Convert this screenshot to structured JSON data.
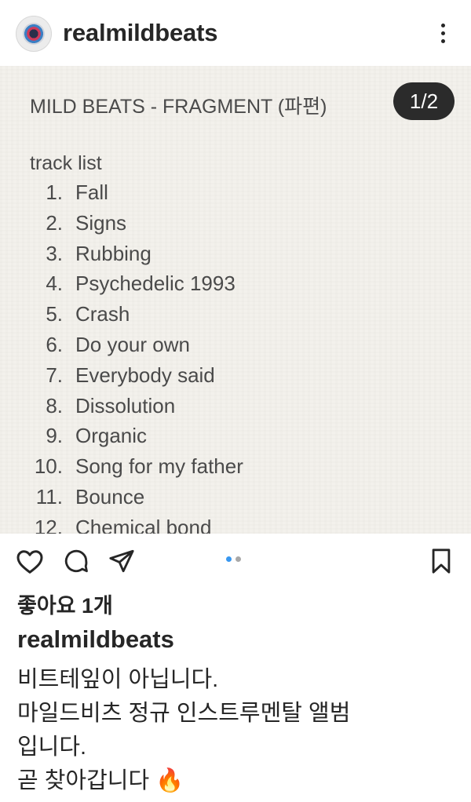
{
  "header": {
    "username": "realmildbeats",
    "more_icon": "more-vertical-icon"
  },
  "post": {
    "title": "MILD BEATS - FRAGMENT (파편)",
    "counter": "1/2",
    "tracklist_heading": "track list",
    "tracks": [
      {
        "num": "1.",
        "name": "Fall"
      },
      {
        "num": "2.",
        "name": "Signs"
      },
      {
        "num": "3.",
        "name": "Rubbing"
      },
      {
        "num": "4.",
        "name": "Psychedelic 1993"
      },
      {
        "num": "5.",
        "name": "Crash"
      },
      {
        "num": "6.",
        "name": "Do your own"
      },
      {
        "num": "7.",
        "name": "Everybody said"
      },
      {
        "num": "8.",
        "name": "Dissolution"
      },
      {
        "num": "9.",
        "name": "Organic"
      },
      {
        "num": "10.",
        "name": "Song for my father"
      },
      {
        "num": "11.",
        "name": "Bounce"
      },
      {
        "num": "12.",
        "name": "Chemical bond"
      }
    ]
  },
  "actions": {
    "icons": [
      "heart-icon",
      "comment-icon",
      "share-icon",
      "bookmark-icon"
    ],
    "carousel_active_color": "#3897f0",
    "carousel_inactive_color": "#a8a8a8"
  },
  "likes": "좋아요 1개",
  "caption": {
    "username": "realmildbeats",
    "lines": [
      "비트테잎이 아닙니다.",
      "마일드비츠 정규 인스트루멘탈 앨범",
      "입니다.",
      "곧 찾아갑니다 🔥"
    ]
  }
}
